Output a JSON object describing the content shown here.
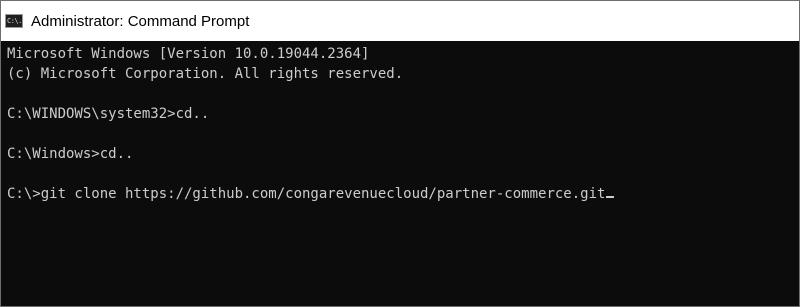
{
  "window": {
    "title": "Administrator: Command Prompt",
    "icon": "cmd-icon",
    "icon_text": "C:\\."
  },
  "console": {
    "lines": [
      "Microsoft Windows [Version 10.0.19044.2364]",
      "(c) Microsoft Corporation. All rights reserved.",
      "",
      "C:\\WINDOWS\\system32>cd..",
      "",
      "C:\\Windows>cd..",
      "",
      "C:\\>git clone https://github.com/congarevenuecloud/partner-commerce.git"
    ]
  },
  "colors": {
    "console_background": "#0c0c0c",
    "console_text": "#cccccc",
    "titlebar_background": "#ffffff"
  }
}
